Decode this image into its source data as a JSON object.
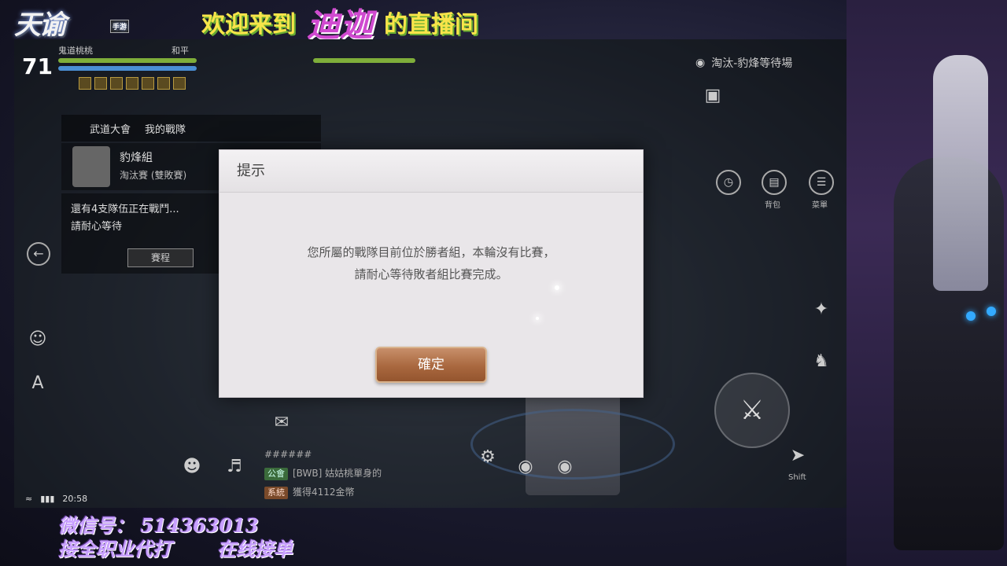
{
  "overlay": {
    "logo_text": "天谕",
    "logo_tag": "手游",
    "banner_prefix": "欢迎来到",
    "streamer_name": "迪迦",
    "banner_suffix": "的直播间",
    "wechat_line": "微信号： 514363013",
    "service_left": "接全职业代打",
    "service_right": "在线接单"
  },
  "hud": {
    "level": "71",
    "player_name": "鬼道桃桃",
    "pk_mode": "和平",
    "tabs": [
      "武道大會",
      "我的戰隊"
    ],
    "team_name": "豹烽組",
    "team_stage": "淘汰賽 (雙敗賽)",
    "waiting_line1": "還有4支隊伍正在戰鬥...",
    "waiting_line2": "請耐心等待",
    "schedule_button": "賽程",
    "zone_title": "淘汰-豹烽等待場",
    "bag_label": "背包",
    "menu_label": "菜單",
    "clock": "20:58",
    "chat_guild_tag": "公會",
    "chat_system_tag": "系統",
    "chat_title": "######",
    "chat_guild_msg": "[BWB] 姑姑桃單身的",
    "chat_system_msg": "獲得4112金幣",
    "skill_label": "Shift",
    "hp_color": "#7fae3a",
    "mp_color": "#4a8fd4"
  },
  "dialog": {
    "title": "提示",
    "message_line1": "您所屬的戰隊目前位於勝者組，本輪沒有比賽，",
    "message_line2": "請耐心等待敗者組比賽完成。",
    "confirm_button": "確定",
    "button_color": "#a9683f"
  }
}
